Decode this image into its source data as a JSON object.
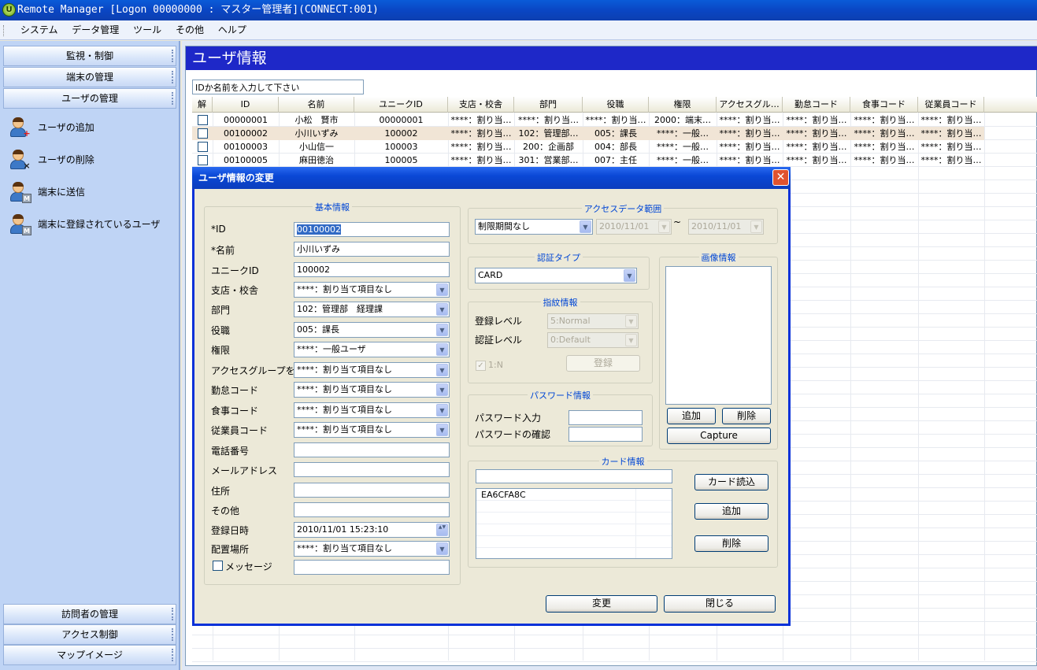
{
  "window": {
    "title": "Remote Manager [Logon 00000000 : マスター管理者](CONNECT:001)"
  },
  "menu": [
    "システム",
    "データ管理",
    "ツール",
    "その他",
    "ヘルプ"
  ],
  "sidebar": {
    "top_sections": [
      "監視・制御",
      "端末の管理",
      "ユーザの管理"
    ],
    "actions": [
      "ユーザの追加",
      "ユーザの削除",
      "端末に送信",
      "端末に登録されているユーザ"
    ],
    "bottom_sections": [
      "訪問者の管理",
      "アクセス制御",
      "マップイメージ"
    ]
  },
  "main": {
    "title": "ユーザ情報",
    "search_value": "IDか名前を入力して下さい",
    "columns": [
      "解",
      "ID",
      "名前",
      "ユニークID",
      "支店・校舎",
      "部門",
      "役職",
      "権限",
      "アクセスグル…",
      "勤怠コード",
      "食事コード",
      "従業員コード"
    ],
    "rows": [
      [
        "",
        "00000001",
        "小松　賢市",
        "00000001",
        "****：割り当…",
        "****：割り当…",
        "****：割り当…",
        "2000：端末…",
        "****：割り当…",
        "****：割り当…",
        "****：割り当…",
        "****：割り当…"
      ],
      [
        "",
        "00100002",
        "小川いずみ",
        "100002",
        "****：割り当…",
        "102：管理部…",
        "005：課長",
        "****：一般…",
        "****：割り当…",
        "****：割り当…",
        "****：割り当…",
        "****：割り当…"
      ],
      [
        "",
        "00100003",
        "小山信一",
        "100003",
        "****：割り当…",
        "200：企画部",
        "004：部長",
        "****：一般…",
        "****：割り当…",
        "****：割り当…",
        "****：割り当…",
        "****：割り当…"
      ],
      [
        "",
        "00100005",
        "麻田徳治",
        "100005",
        "****：割り当…",
        "301：営業部…",
        "007：主任",
        "****：一般…",
        "****：割り当…",
        "****：割り当…",
        "****：割り当…",
        "****：割り当…"
      ]
    ]
  },
  "dialog": {
    "title": "ユーザ情報の変更",
    "basic": {
      "legend": "基本情報",
      "fields": [
        {
          "label": "*ID",
          "value": "00100002",
          "kind": "text"
        },
        {
          "label": "*名前",
          "value": "小川いずみ",
          "kind": "text"
        },
        {
          "label": "ユニークID",
          "value": "100002",
          "kind": "text"
        },
        {
          "label": "支店・校舎",
          "value": "****：割り当て項目なし",
          "kind": "combo"
        },
        {
          "label": "部門",
          "value": "102：管理部　経理課",
          "kind": "combo"
        },
        {
          "label": "役職",
          "value": "005：課長",
          "kind": "combo"
        },
        {
          "label": "権限",
          "value": "****：一般ユーザ",
          "kind": "combo"
        },
        {
          "label": "アクセスグループを追",
          "value": "****：割り当て項目なし",
          "kind": "combo"
        },
        {
          "label": "勤怠コード",
          "value": "****：割り当て項目なし",
          "kind": "combo"
        },
        {
          "label": "食事コード",
          "value": "****：割り当て項目なし",
          "kind": "combo"
        },
        {
          "label": "従業員コード",
          "value": "****：割り当て項目なし",
          "kind": "combo"
        },
        {
          "label": "電話番号",
          "value": "",
          "kind": "text"
        },
        {
          "label": "メールアドレス",
          "value": "",
          "kind": "text"
        },
        {
          "label": "住所",
          "value": "",
          "kind": "text"
        },
        {
          "label": "その他",
          "value": "",
          "kind": "text"
        },
        {
          "label": "登録日時",
          "value": "2010/11/01 15:23:10",
          "kind": "spin"
        },
        {
          "label": "配置場所",
          "value": "****：割り当て項目なし",
          "kind": "combo"
        }
      ],
      "message_label": "メッセージ",
      "message_value": ""
    },
    "access_range": {
      "legend": "アクセスデータ範囲",
      "mode": "制限期間なし",
      "from": "2010/11/01",
      "sep": "~",
      "to": "2010/11/01"
    },
    "auth_type": {
      "legend": "認証タイプ",
      "value": "CARD"
    },
    "finger": {
      "legend": "指紋情報",
      "reg_label": "登録レベル",
      "reg_value": "5:Normal",
      "auth_label": "認証レベル",
      "auth_value": "0:Default",
      "one_n": "1:N",
      "register_button": "登録"
    },
    "password": {
      "legend": "パスワード情報",
      "input_label": "パスワード入力",
      "confirm_label": "パスワードの確認"
    },
    "image": {
      "legend": "画像情報",
      "add": "追加",
      "delete": "削除",
      "capture": "Capture"
    },
    "card": {
      "legend": "カード情報",
      "input_value": "",
      "list": [
        "EA6CFA8C"
      ],
      "read": "カード読込",
      "add": "追加",
      "delete": "削除"
    },
    "buttons": {
      "change": "変更",
      "close": "閉じる"
    }
  }
}
